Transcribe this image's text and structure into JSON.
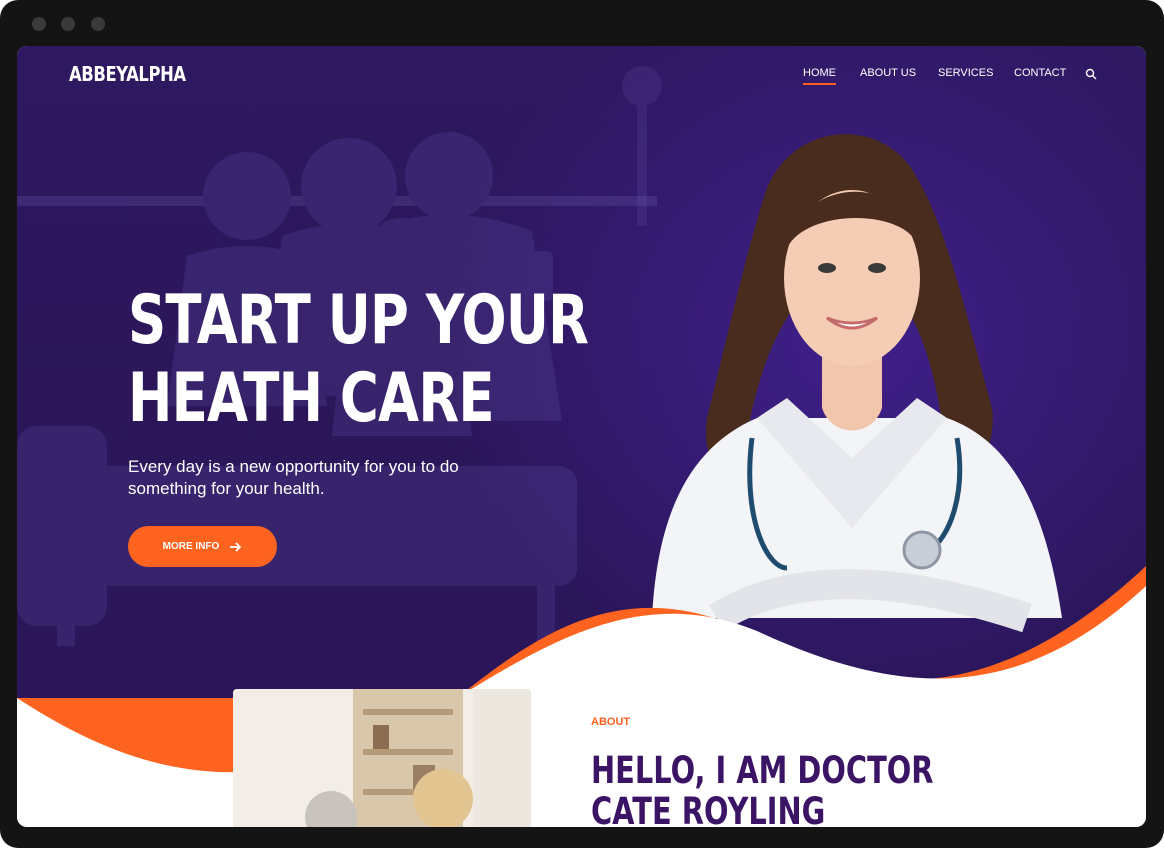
{
  "brand": {
    "name": "ABBEYALPHA"
  },
  "nav": {
    "items": [
      {
        "label": "HOME",
        "active": true
      },
      {
        "label": "ABOUT US",
        "active": false
      },
      {
        "label": "SERVICES",
        "active": false
      },
      {
        "label": "CONTACT",
        "active": false
      }
    ],
    "search_icon": "search-icon"
  },
  "hero": {
    "headline_line1": "START UP YOUR",
    "headline_line2": "HEATH CARE",
    "subtitle": "Every day is a new opportunity for you to do something for your health.",
    "cta_label": "MORE INFO",
    "cta_icon": "arrow-right-icon"
  },
  "about": {
    "label": "ABOUT",
    "title_line1": "HELLO, I AM DOCTOR",
    "title_line2": "CATE ROYLING"
  },
  "colors": {
    "primary": "#2d1760",
    "accent": "#ff6320",
    "heading_dark": "#3b1466"
  }
}
